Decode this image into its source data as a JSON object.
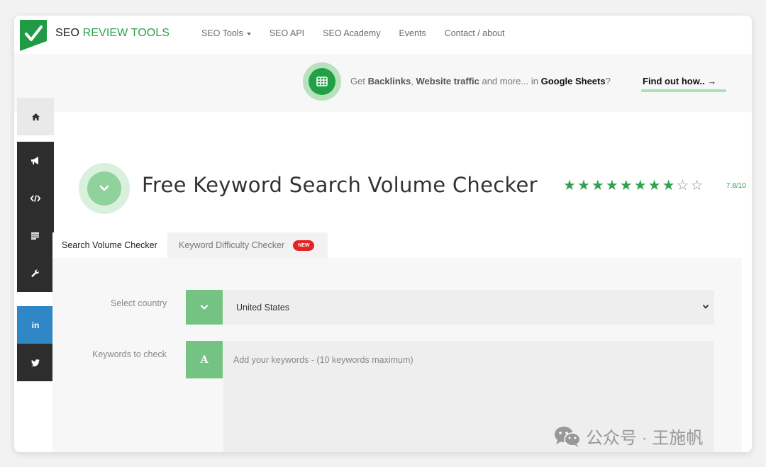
{
  "brand": {
    "name_part1": "SEO ",
    "name_part2": "REVIEW TOOLS",
    "accent_color": "#2aa34a"
  },
  "nav": {
    "items": [
      {
        "label": "SEO Tools",
        "has_caret": true
      },
      {
        "label": "SEO API"
      },
      {
        "label": "SEO Academy"
      },
      {
        "label": "Events"
      },
      {
        "label": "Contact / about"
      }
    ]
  },
  "promo": {
    "icon": "spreadsheet-icon",
    "text_get": "Get ",
    "text_backlinks": "Backlinks",
    "text_comma": ", ",
    "text_traffic": "Website traffic",
    "text_more": " and more... in ",
    "text_sheets": "Google Sheets",
    "text_q": "?",
    "cta": "Find out how.. →"
  },
  "sidebar": {
    "items": [
      {
        "icon": "home-icon"
      },
      {
        "icon": "megaphone-icon"
      },
      {
        "icon": "code-icon"
      },
      {
        "icon": "list-icon"
      },
      {
        "icon": "wrench-icon"
      },
      {
        "icon": "linkedin-icon",
        "label": "in"
      },
      {
        "icon": "twitter-icon"
      }
    ]
  },
  "hero": {
    "icon": "chevron-down-icon",
    "title": "Free Keyword Search Volume Checker",
    "rating_stars": 8,
    "rating_total_stars": 10,
    "rating_text": "7.8/10"
  },
  "tabs": [
    {
      "label": "Search Volume Checker",
      "active": true
    },
    {
      "label": "Keyword Difficulty Checker",
      "active": false,
      "badge": "NEW"
    }
  ],
  "form": {
    "country_label": "Select country",
    "country_value": "United States",
    "keywords_label": "Keywords to check",
    "keywords_icon_letter": "A",
    "keywords_placeholder": "Add your keywords - (10 keywords maximum)"
  },
  "watermark": {
    "text": "公众号 · 王施帆",
    "icon": "wechat-icon"
  },
  "colors": {
    "green": "#74c382",
    "dark_green": "#22a046",
    "sidebar_dark": "#2d2d2d",
    "linkedin_blue": "#2f87c6",
    "badge_red": "#e02525"
  }
}
